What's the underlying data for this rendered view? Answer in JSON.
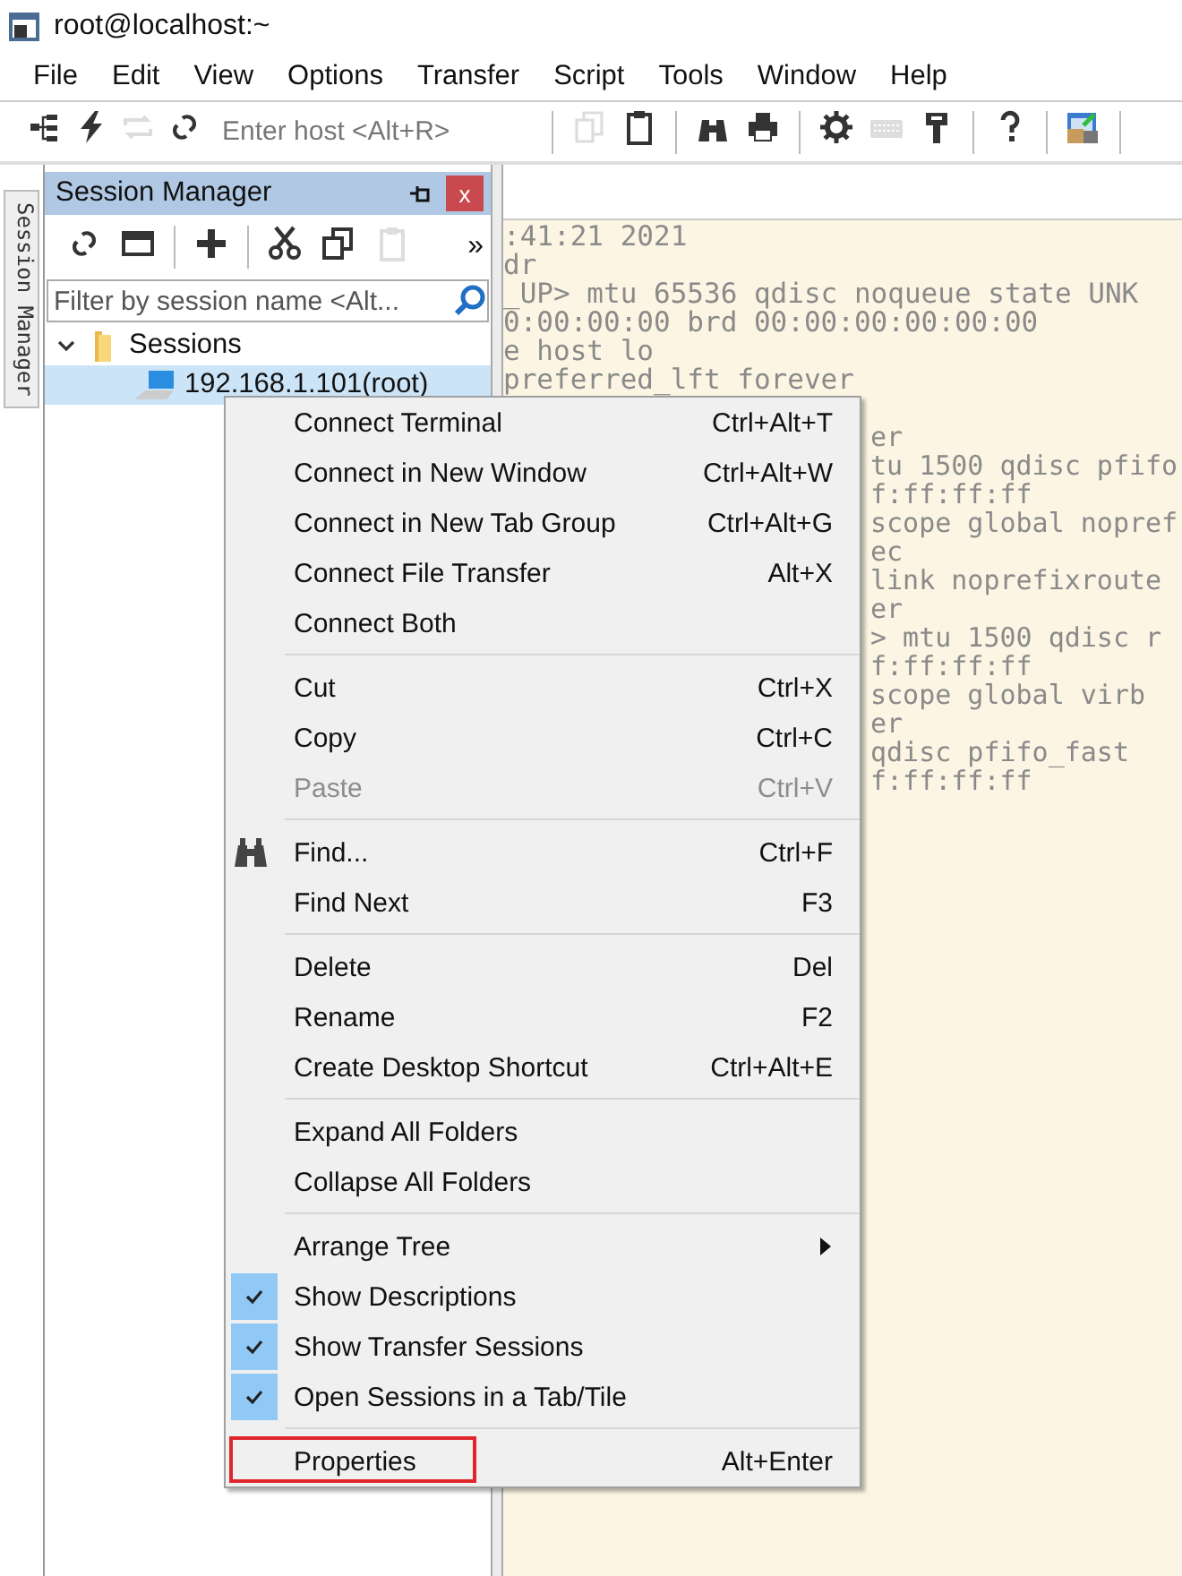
{
  "window": {
    "title": "root@localhost:~"
  },
  "menu_bar": [
    "File",
    "Edit",
    "View",
    "Options",
    "Transfer",
    "Script",
    "Tools",
    "Window",
    "Help"
  ],
  "toolbar": {
    "buttons_left": [
      {
        "disabled": false
      },
      {
        "disabled": false
      },
      {
        "disabled": true
      },
      {
        "disabled": false
      }
    ],
    "host_field": {
      "placeholder": "Enter host <Alt+R>"
    },
    "buttons_right": [
      {
        "disabled": true
      },
      {
        "disabled": false
      },
      {
        "disabled": false
      },
      {
        "disabled": false
      },
      {
        "disabled": false
      },
      {
        "disabled": true
      },
      {
        "disabled": false
      },
      {
        "disabled": false
      },
      {
        "disabled": false
      }
    ]
  },
  "side_tab": {
    "label": "Session Manager"
  },
  "session_manager": {
    "title": "Session Manager",
    "close": "x",
    "toolbar": [
      {
        "disabled": false
      },
      {
        "disabled": false
      },
      {
        "disabled": false
      },
      {
        "disabled": false
      },
      {
        "disabled": false
      },
      {
        "disabled": true
      }
    ],
    "overflow": "»",
    "filter": {
      "placeholder": "Filter by session name <Alt..."
    },
    "tree": [
      {
        "label": "Sessions",
        "expanded": true,
        "selected": false,
        "children": [
          {
            "label": "192.168.1.101(root)",
            "selected": true
          }
        ]
      }
    ]
  },
  "terminal": {
    "lines": [
      ":41:21 2021",
      "dr",
      "_UP> mtu 65536 qdisc noqueue state UNK",
      "0:00:00:00 brd 00:00:00:00:00:00",
      "e host lo",
      "preferred_lft forever"
    ],
    "lines_beside_menu": [
      "er",
      "tu 1500 qdisc pfifo",
      "f:ff:ff:ff",
      "scope global nopref",
      "ec",
      "link noprefixroute",
      "er",
      "> mtu 1500 qdisc r",
      "f:ff:ff:ff",
      "scope global virb",
      "er",
      "qdisc pfifo_fast",
      "f:ff:ff:ff"
    ]
  },
  "context_menu": [
    {
      "kind": "item",
      "label": "Connect Terminal",
      "shortcut": "Ctrl+Alt+T",
      "disabled": false,
      "checked": false
    },
    {
      "kind": "item",
      "label": "Connect in New Window",
      "shortcut": "Ctrl+Alt+W",
      "disabled": false,
      "checked": false
    },
    {
      "kind": "item",
      "label": "Connect in New Tab Group",
      "shortcut": "Ctrl+Alt+G",
      "disabled": false,
      "checked": false
    },
    {
      "kind": "item",
      "label": "Connect File Transfer",
      "shortcut": "Alt+X",
      "disabled": false,
      "checked": false
    },
    {
      "kind": "item",
      "label": "Connect Both",
      "disabled": false,
      "checked": false
    },
    {
      "kind": "separator"
    },
    {
      "kind": "item",
      "label": "Cut",
      "shortcut": "Ctrl+X",
      "disabled": false,
      "checked": false
    },
    {
      "kind": "item",
      "label": "Copy",
      "shortcut": "Ctrl+C",
      "disabled": false,
      "checked": false
    },
    {
      "kind": "item",
      "label": "Paste",
      "shortcut": "Ctrl+V",
      "disabled": true,
      "checked": false
    },
    {
      "kind": "separator"
    },
    {
      "kind": "icon_item",
      "label": "Find...",
      "shortcut": "Ctrl+F",
      "disabled": false,
      "checked": false
    },
    {
      "kind": "item",
      "label": "Find Next",
      "shortcut": "F3",
      "disabled": false,
      "checked": false
    },
    {
      "kind": "separator"
    },
    {
      "kind": "item",
      "label": "Delete",
      "shortcut": "Del",
      "disabled": false,
      "checked": false
    },
    {
      "kind": "item",
      "label": "Rename",
      "shortcut": "F2",
      "disabled": false,
      "checked": false
    },
    {
      "kind": "item",
      "label": "Create Desktop Shortcut",
      "shortcut": "Ctrl+Alt+E",
      "disabled": false,
      "checked": false
    },
    {
      "kind": "separator"
    },
    {
      "kind": "item",
      "label": "Expand All Folders",
      "disabled": false,
      "checked": false
    },
    {
      "kind": "item",
      "label": "Collapse All Folders",
      "disabled": false,
      "checked": false
    },
    {
      "kind": "separator"
    },
    {
      "kind": "submenu",
      "label": "Arrange Tree",
      "disabled": false,
      "checked": false
    },
    {
      "kind": "item",
      "label": "Show Descriptions",
      "disabled": false,
      "checked": true
    },
    {
      "kind": "item",
      "label": "Show Transfer Sessions",
      "disabled": false,
      "checked": true
    },
    {
      "kind": "item",
      "label": "Open Sessions in a Tab/Tile",
      "disabled": false,
      "checked": true
    },
    {
      "kind": "separator"
    },
    {
      "kind": "item",
      "label": "Properties",
      "shortcut": "Alt+Enter",
      "disabled": false,
      "checked": false,
      "highlighted": true
    }
  ]
}
